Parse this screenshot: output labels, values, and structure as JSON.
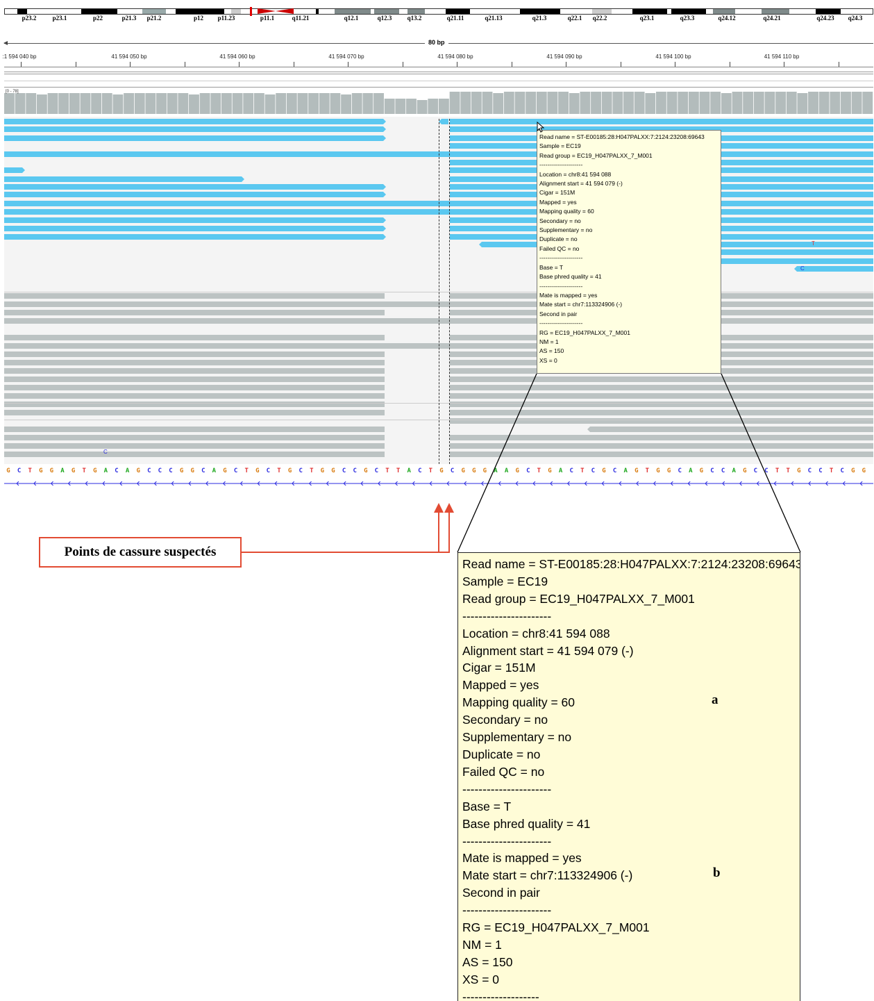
{
  "ideogram": {
    "bands": [
      "p23.2",
      "p23.1",
      "p22",
      "p21.3",
      "p21.2",
      "p12",
      "p11.23",
      "p11.1",
      "q11.21",
      "q12.1",
      "q12.3",
      "q13.2",
      "q21.11",
      "q21.13",
      "q21.3",
      "q22.1",
      "q22.2",
      "q23.1",
      "q23.3",
      "q24.12",
      "q24.21",
      "q24.23",
      "q24.3"
    ]
  },
  "ruler": {
    "span": "80 bp",
    "ticks": [
      "41 594 040 bp",
      "41 594 050 bp",
      "41 594 060 bp",
      "41 594 070 bp",
      "41 594 080 bp",
      "41 594 090 bp",
      "41 594 100 bp",
      "41 594 110 bp"
    ],
    "first_tick_display": ":1 594 040 bp"
  },
  "coverage": {
    "range": "[0 - 78]",
    "color": "#b3bcbc"
  },
  "reads": {
    "colors": {
      "forward": "#5bc8f0",
      "gray": "#bcc3c3"
    },
    "mismatch_T": "T",
    "mismatch_C": "C"
  },
  "reference": {
    "sequence": "GCTGGAGTGACAGCCCGGCAGCTGCTGCTGGCCGCTTACTGCGGGAAGCTGACTCGCAGTGGCAGCCAGCCTTGCCTCGG",
    "colors": {
      "A": "#1fa81f",
      "C": "#2929e0",
      "G": "#d97b0e",
      "T": "#e03030"
    }
  },
  "tooltip": {
    "lines": [
      "Read name = ST-E00185:28:H047PALXX:7:2124:23208:69643",
      "Sample = EC19",
      "Read group = EC19_H047PALXX_7_M001",
      "----------------------",
      "Location = chr8:41 594 088",
      "Alignment start = 41 594 079 (-)",
      "Cigar = 151M",
      "Mapped = yes",
      "Mapping quality = 60",
      "Secondary = no",
      "Supplementary = no",
      "Duplicate = no",
      "Failed QC = no",
      "----------------------",
      "Base = T",
      "Base phred quality = 41",
      "----------------------",
      "Mate is mapped = yes",
      "Mate start = chr7:113324906 (-)",
      "Second in pair",
      "----------------------",
      "RG = EC19_H047PALXX_7_M001",
      "NM = 1",
      "AS = 150",
      "XS = 0",
      "-------------------"
    ]
  },
  "annotation": {
    "breakpoints_label": "Points de cassure suspectés",
    "brace_a": "a",
    "brace_b": "b",
    "arrow_color": "#e24b33"
  }
}
